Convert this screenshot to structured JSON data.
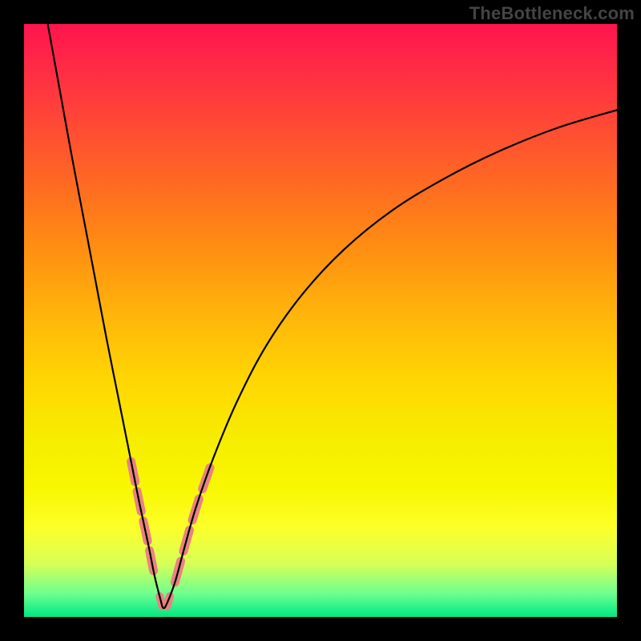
{
  "watermark": "TheBottleneck.com",
  "colors": {
    "frame": "#000000",
    "curve": "#000000",
    "bead": "#e9837f",
    "gradient_stops": [
      "#ff144e",
      "#ff2a46",
      "#ff4338",
      "#ff6a22",
      "#ff8f12",
      "#ffb80a",
      "#ffd602",
      "#f6ed00",
      "#f8f700",
      "#fdff2a",
      "#d7ff57",
      "#6fff8f",
      "#00e884"
    ]
  },
  "chart_data": {
    "type": "line",
    "title": "",
    "xlabel": "",
    "ylabel": "",
    "xlim": [
      0,
      100
    ],
    "ylim": [
      0,
      100
    ],
    "notes": "Single V-shaped curve. x is normalized horizontal position (0=left plot edge, 100=right). y is normalized vertical (0=bottom green band, 100=top of plot). Minimum near x≈23.5. Curve estimated from pixels; no axis ticks or numeric labels are shown in the image.",
    "series": [
      {
        "name": "curve",
        "x": [
          4.0,
          6.0,
          8.0,
          10.0,
          12.0,
          14.0,
          16.0,
          18.0,
          19.5,
          21.0,
          22.0,
          23.0,
          23.5,
          24.2,
          25.5,
          27.0,
          29.0,
          32.0,
          36.0,
          41.0,
          47.0,
          54.0,
          62.0,
          71.0,
          80.0,
          90.0,
          100.0
        ],
        "y": [
          100.0,
          89.0,
          78.0,
          67.5,
          57.0,
          46.5,
          36.5,
          26.5,
          19.0,
          12.0,
          7.0,
          3.0,
          1.5,
          2.5,
          6.0,
          11.5,
          18.5,
          27.0,
          36.5,
          46.0,
          54.5,
          62.0,
          68.5,
          74.0,
          78.5,
          82.5,
          85.5
        ]
      }
    ],
    "beads": {
      "description": "Short pink capsule segments along the lower part of the V, on both branches.",
      "left_branch_y_range": [
        7,
        27
      ],
      "right_branch_y_range": [
        5,
        26
      ],
      "bottom_y_range": [
        1.5,
        3.5
      ]
    }
  }
}
